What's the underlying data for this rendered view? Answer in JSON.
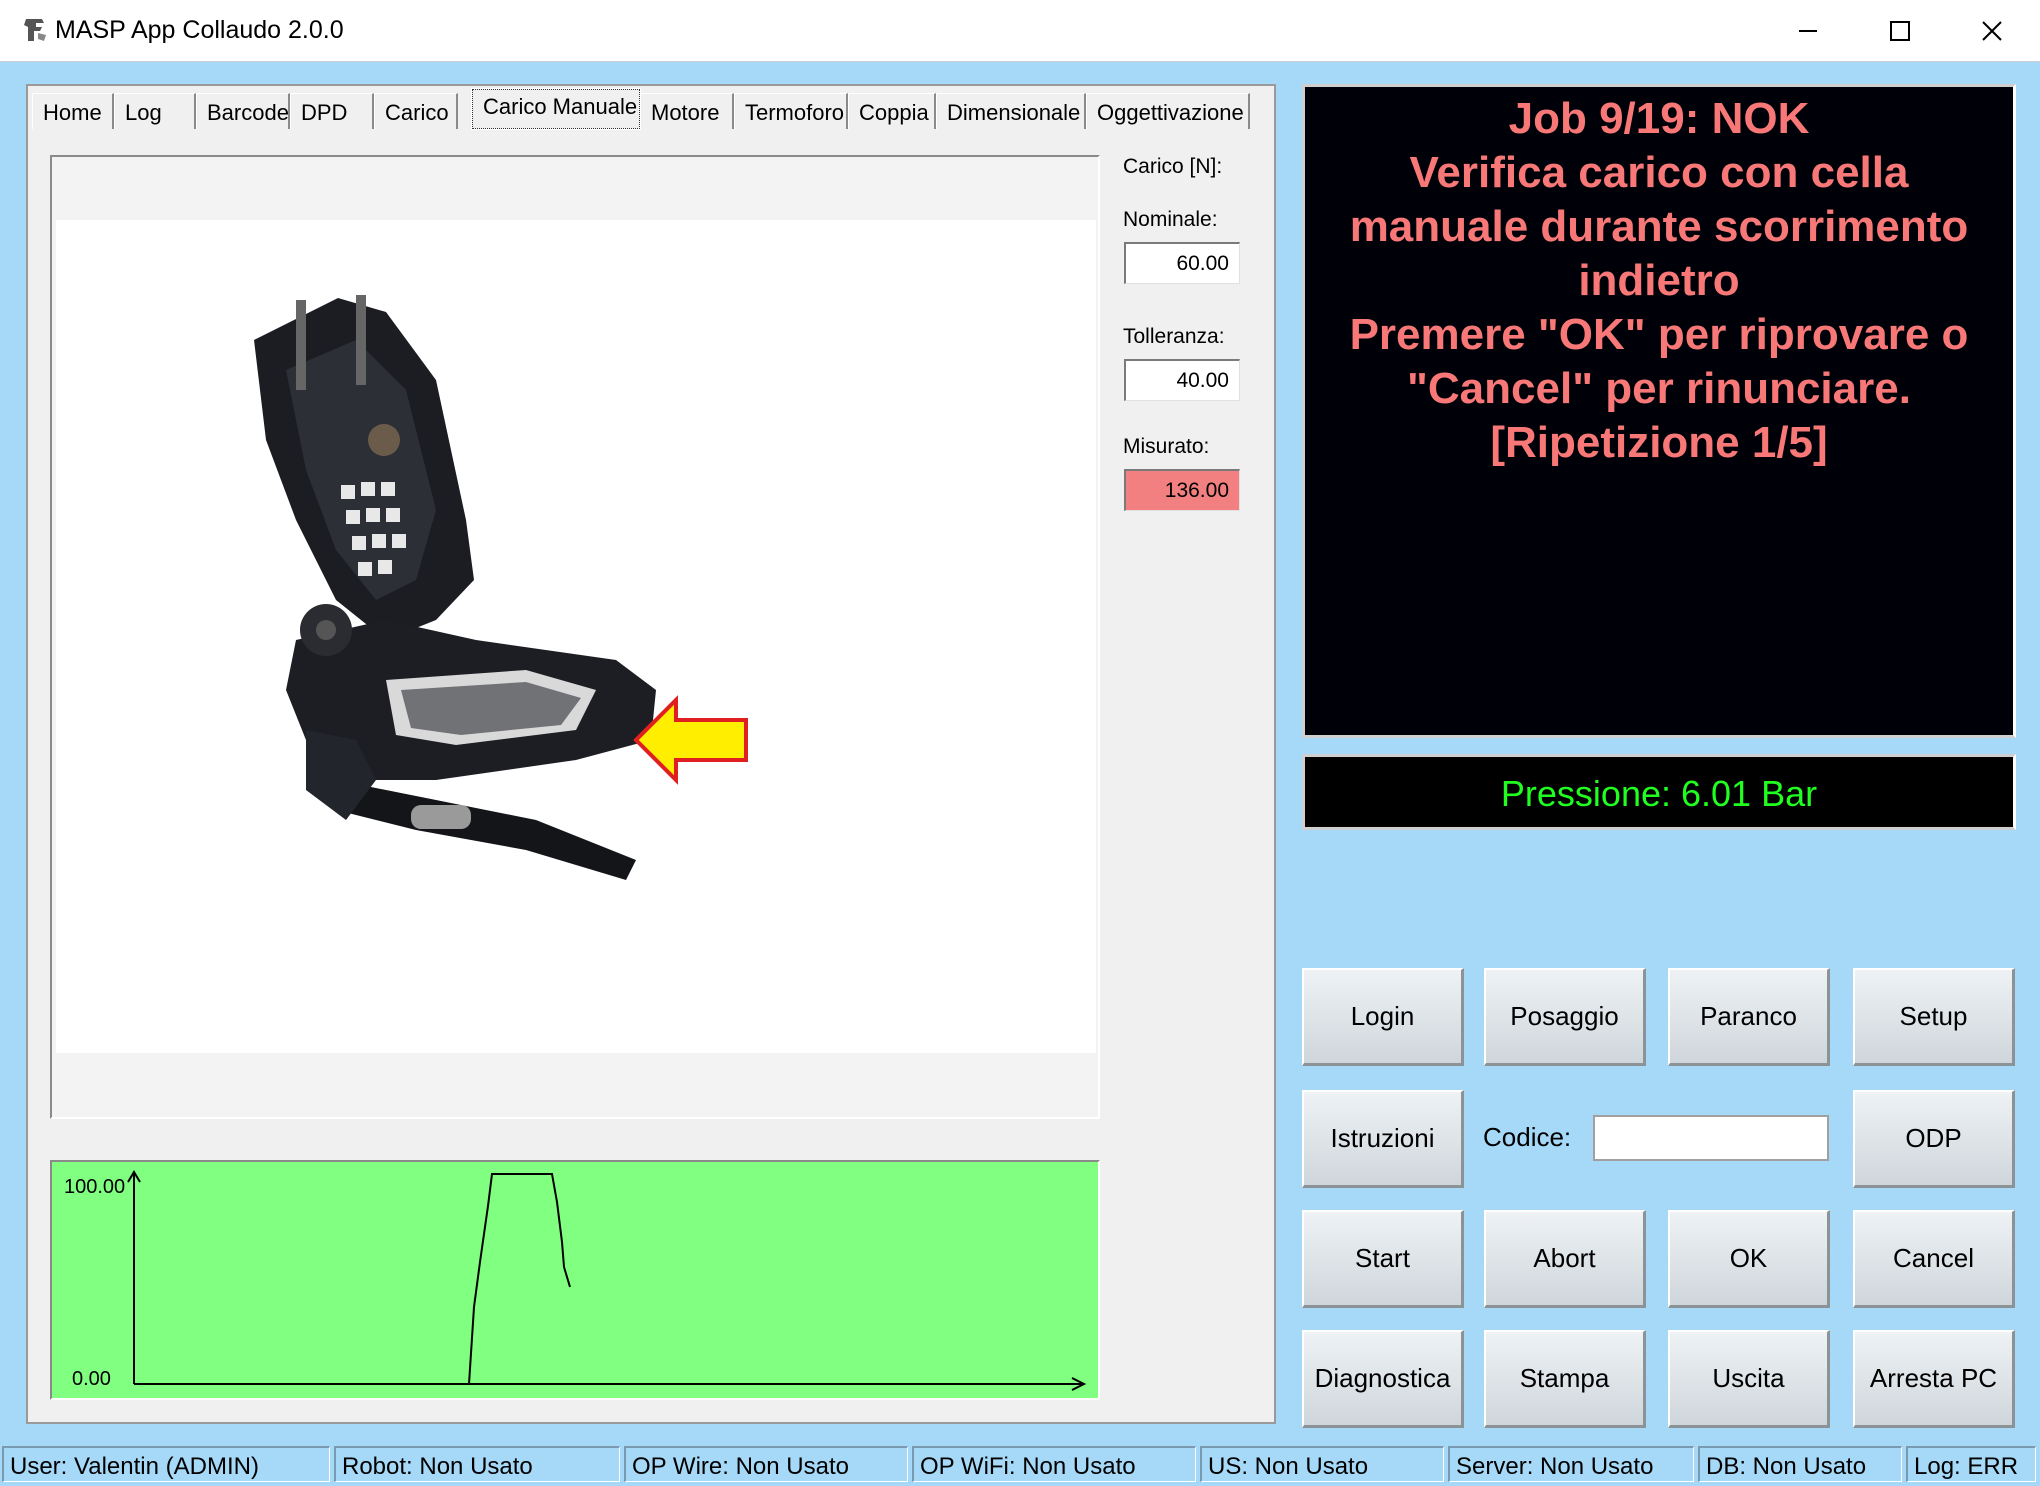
{
  "window": {
    "title": "MASP App Collaudo 2.0.0"
  },
  "tabs": [
    {
      "label": "Home"
    },
    {
      "label": "Log"
    },
    {
      "label": "Barcode"
    },
    {
      "label": "DPD"
    },
    {
      "label": "Carico"
    },
    {
      "label": "Carico Manuale",
      "active": true
    },
    {
      "label": "Motore"
    },
    {
      "label": "Termoforo"
    },
    {
      "label": "Coppia"
    },
    {
      "label": "Dimensionale"
    },
    {
      "label": "Oggettivazione"
    }
  ],
  "fields": {
    "carico_label": "Carico [N]:",
    "nominale_label": "Nominale:",
    "nominale_value": "60.00",
    "tolleranza_label": "Tolleranza:",
    "tolleranza_value": "40.00",
    "misurato_label": "Misurato:",
    "misurato_value": "136.00"
  },
  "graph": {
    "y_max_label": "100.00",
    "y_min_label": "0.00"
  },
  "message": {
    "text": "Job 9/19: NOK\nVerifica carico con cella\nmanuale durante scorrimento\nindietro\nPremere \"OK\" per riprovare o\n\"Cancel\" per rinunciare.\n[Ripetizione 1/5]"
  },
  "pressure": {
    "text": "Pressione: 6.01 Bar"
  },
  "buttons": {
    "login": "Login",
    "posaggio": "Posaggio",
    "paranco": "Paranco",
    "setup": "Setup",
    "istruzioni": "Istruzioni",
    "codice_label": "Codice:",
    "codice_value": "",
    "odp": "ODP",
    "start": "Start",
    "abort": "Abort",
    "ok": "OK",
    "cancel": "Cancel",
    "diagnostica": "Diagnostica",
    "stampa": "Stampa",
    "uscita": "Uscita",
    "arresta_pc": "Arresta PC"
  },
  "statusbar": [
    {
      "text": "User: Valentin (ADMIN)"
    },
    {
      "text": "Robot: Non Usato"
    },
    {
      "text": "OP Wire: Non Usato"
    },
    {
      "text": "OP WiFi: Non Usato"
    },
    {
      "text": "US: Non Usato"
    },
    {
      "text": "Server: Non Usato"
    },
    {
      "text": "DB: Non Usato"
    },
    {
      "text": "Log: ERR"
    }
  ],
  "colors": {
    "background": "#a6d9f7",
    "message_text": "#f87878",
    "pressure_text": "#20ff20",
    "graph_bg": "#80ff80",
    "nok_field": "#f38080"
  }
}
